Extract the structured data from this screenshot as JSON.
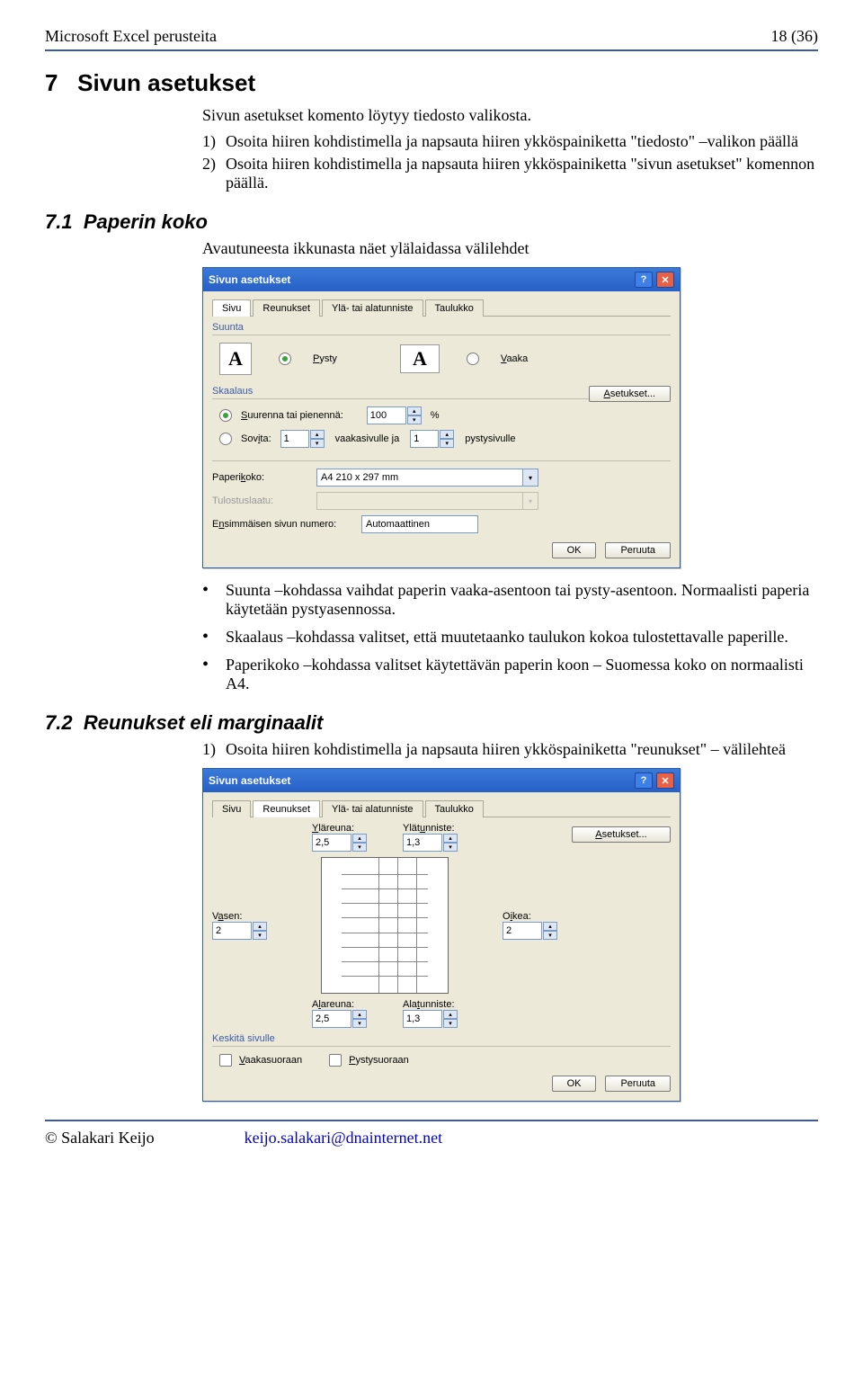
{
  "header": {
    "left": "Microsoft Excel perusteita",
    "right": "18 (36)"
  },
  "h1": {
    "num": "7",
    "title": "Sivun asetukset"
  },
  "intro": "Sivun asetukset komento löytyy tiedosto valikosta.",
  "steps7": {
    "s1": "Osoita hiiren kohdistimella ja napsauta hiiren ykköspainiketta \"tiedosto\" –valikon päällä",
    "s2": "Osoita hiiren kohdistimella ja napsauta hiiren ykköspainiketta \"sivun asetukset\" komennon päällä."
  },
  "h71": {
    "num": "7.1",
    "title": "Paperin koko"
  },
  "p71": "Avautuneesta ikkunasta näet ylälaidassa välilehdet",
  "dialog": {
    "title": "Sivun asetukset",
    "tabs": {
      "sivu": "Sivu",
      "reunukset": "Reunukset",
      "ylaalat": "Ylä- tai alatunniste",
      "taulukko": "Taulukko"
    },
    "suunta": {
      "label": "Suunta",
      "pysty": "Pysty",
      "vaaka": "Vaaka"
    },
    "skaalaus": {
      "label": "Skaalaus",
      "suurenna": "Suurenna tai pienennä:",
      "pct": "100",
      "pctunit": "%",
      "sovita": "Sovita:",
      "w": "1",
      "mid": "vaakasivulle ja",
      "h": "1",
      "end": "pystysivulle"
    },
    "asetukset": "Asetukset...",
    "paperikoko": {
      "label": "Paperikoko:",
      "value": "A4 210 x 297 mm"
    },
    "tulostuslaatu": {
      "label": "Tulostuslaatu:"
    },
    "ensnum": {
      "label": "Ensimmäisen sivun numero:",
      "value": "Automaattinen"
    },
    "ok": "OK",
    "peruuta": "Peruuta"
  },
  "bullets1": {
    "b1": "Suunta –kohdassa vaihdat paperin vaaka-asentoon tai pysty-asentoon. Normaalisti paperia käytetään pystyasennossa.",
    "b2": "Skaalaus –kohdassa valitset, että muutetaanko taulukon kokoa tulostettavalle paperille.",
    "b3": "Paperikoko –kohdassa valitset käytettävän paperin koon – Suomessa koko on normaalisti A4."
  },
  "h72": {
    "num": "7.2",
    "title": "Reunukset eli marginaalit"
  },
  "steps72": {
    "s1": "Osoita hiiren kohdistimella ja napsauta hiiren ykköspainiketta \"reunukset\" – välilehteä"
  },
  "dialog2": {
    "ylareuna": {
      "label": "Yläreuna:",
      "value": "2,5"
    },
    "ylatunniste": {
      "label": "Ylätunniste:",
      "value": "1,3"
    },
    "vasen": {
      "label": "Vasen:",
      "value": "2"
    },
    "oikea": {
      "label": "Oikea:",
      "value": "2"
    },
    "alareuna": {
      "label": "Alareuna:",
      "value": "2,5"
    },
    "alatunniste": {
      "label": "Alatunniste:",
      "value": "1,3"
    },
    "keskita": {
      "label": "Keskitä sivulle",
      "vaaka": "Vaakasuoraan",
      "pysty": "Pystysuoraan"
    }
  },
  "footer": {
    "author": "© Salakari Keijo",
    "email": "keijo.salakari@dnainternet.net"
  }
}
